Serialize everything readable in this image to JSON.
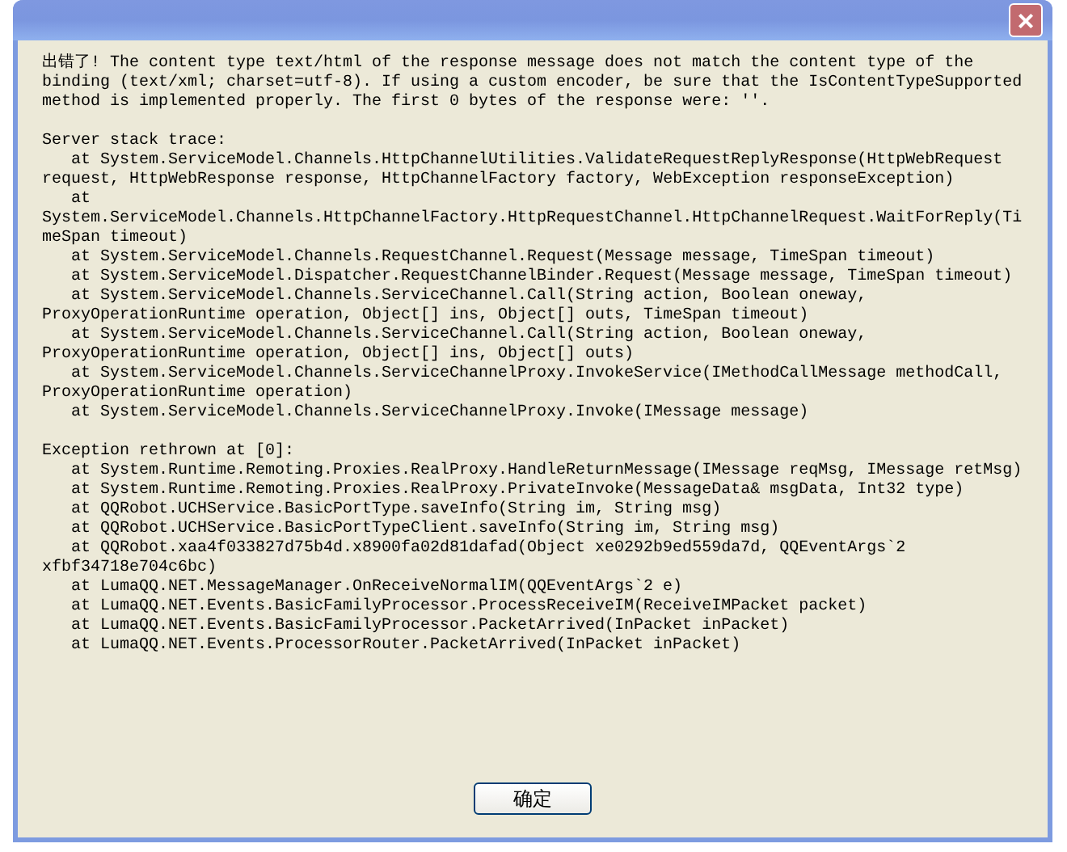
{
  "window": {
    "close_label": "×"
  },
  "message": "出错了! The content type text/html of the response message does not match the content type of the binding (text/xml; charset=utf-8). If using a custom encoder, be sure that the IsContentTypeSupported method is implemented properly. The first 0 bytes of the response were: ''.",
  "sections": [
    {
      "heading": "Server stack trace:",
      "frames": [
        "at System.ServiceModel.Channels.HttpChannelUtilities.ValidateRequestReplyResponse(HttpWebRequest request, HttpWebResponse response, HttpChannelFactory factory, WebException responseException)",
        "at System.ServiceModel.Channels.HttpChannelFactory.HttpRequestChannel.HttpChannelRequest.WaitForReply(TimeSpan timeout)",
        "at System.ServiceModel.Channels.RequestChannel.Request(Message message, TimeSpan timeout)",
        "at System.ServiceModel.Dispatcher.RequestChannelBinder.Request(Message message, TimeSpan timeout)",
        "at System.ServiceModel.Channels.ServiceChannel.Call(String action, Boolean oneway, ProxyOperationRuntime operation, Object[] ins, Object[] outs, TimeSpan timeout)",
        "at System.ServiceModel.Channels.ServiceChannel.Call(String action, Boolean oneway, ProxyOperationRuntime operation, Object[] ins, Object[] outs)",
        "at System.ServiceModel.Channels.ServiceChannelProxy.InvokeService(IMethodCallMessage methodCall, ProxyOperationRuntime operation)",
        "at System.ServiceModel.Channels.ServiceChannelProxy.Invoke(IMessage message)"
      ]
    },
    {
      "heading": "Exception rethrown at [0]:",
      "frames": [
        "at System.Runtime.Remoting.Proxies.RealProxy.HandleReturnMessage(IMessage reqMsg, IMessage retMsg)",
        "at System.Runtime.Remoting.Proxies.RealProxy.PrivateInvoke(MessageData& msgData, Int32 type)",
        "at QQRobot.UCHService.BasicPortType.saveInfo(String im, String msg)",
        "at QQRobot.UCHService.BasicPortTypeClient.saveInfo(String im, String msg)",
        "at QQRobot.xaa4f033827d75b4d.x8900fa02d81dafad(Object xe0292b9ed559da7d, QQEventArgs`2 xfbf34718e704c6bc)",
        "at LumaQQ.NET.MessageManager.OnReceiveNormalIM(QQEventArgs`2 e)",
        "at LumaQQ.NET.Events.BasicFamilyProcessor.ProcessReceiveIM(ReceiveIMPacket packet)",
        "at LumaQQ.NET.Events.BasicFamilyProcessor.PacketArrived(InPacket inPacket)",
        "at LumaQQ.NET.Events.ProcessorRouter.PacketArrived(InPacket inPacket)"
      ]
    }
  ],
  "buttons": [
    "确定"
  ]
}
